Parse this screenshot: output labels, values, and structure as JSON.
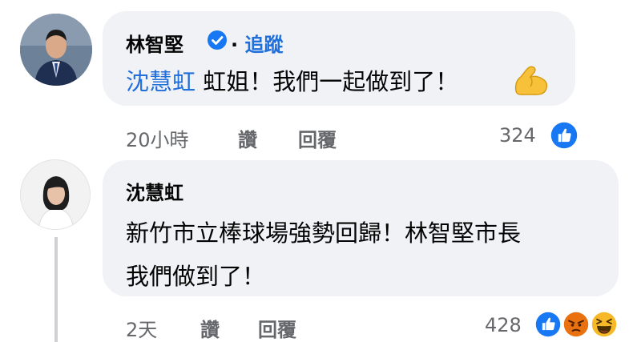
{
  "comments": [
    {
      "author": "林智堅",
      "separator": "·",
      "follow_label": "追蹤",
      "mention": "沈慧虹",
      "text": " 虹姐！我們一起做到了！",
      "emoji_icon": "flexed-biceps-icon",
      "time": "20小時",
      "like_label": "讚",
      "reply_label": "回覆",
      "reaction_count": "324",
      "reactions": [
        "like-icon"
      ]
    },
    {
      "author": "沈慧虹",
      "text_line1": "新竹市立棒球場強勢回歸！林智堅市長",
      "text_line2": "我們做到了！",
      "time": "2天",
      "like_label": "讚",
      "reply_label": "回覆",
      "reaction_count": "428",
      "reactions": [
        "like-icon",
        "angry-icon",
        "haha-icon"
      ]
    }
  ],
  "colors": {
    "link": "#216fdb",
    "like": "#1877f2",
    "angry": "#e9710f",
    "haha": "#f7b928",
    "bubble": "#f0f2f5",
    "meta": "#65676b"
  }
}
